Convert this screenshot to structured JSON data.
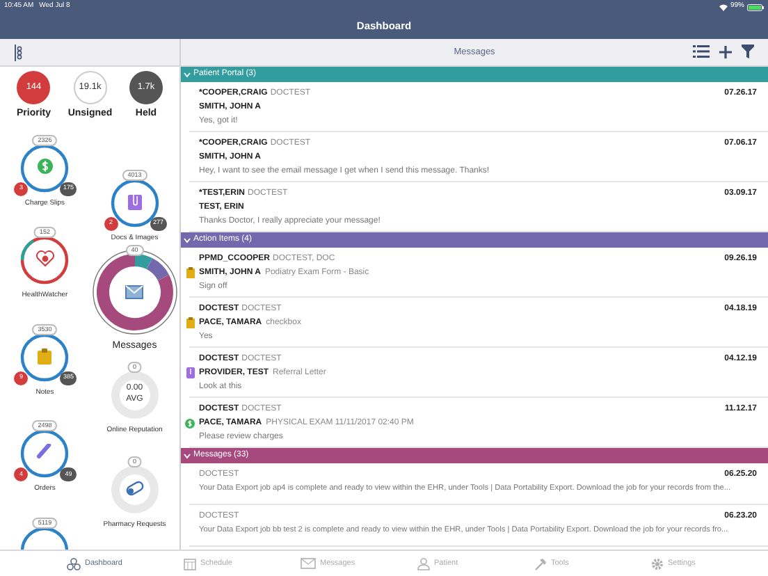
{
  "status_bar": {
    "time": "10:45 AM",
    "date": "Wed Jul 8",
    "battery": "99%"
  },
  "nav": {
    "title": "Dashboard"
  },
  "panel_header": {
    "title": "Messages"
  },
  "summary": [
    {
      "kind": "red",
      "count": "144",
      "label": "Priority"
    },
    {
      "kind": "outline",
      "count": "19.1k",
      "label": "Unsigned"
    },
    {
      "kind": "dark",
      "count": "1.7k",
      "label": "Held"
    }
  ],
  "left_widgets": [
    {
      "kind": "ring",
      "label": "Charge Slips",
      "total": "2326",
      "red": "3",
      "dark": "175"
    },
    {
      "kind": "health",
      "label": "HealthWatcher",
      "total": "152"
    },
    {
      "kind": "ring",
      "label": "Notes",
      "total": "3530",
      "red": "9",
      "dark": "385"
    },
    {
      "kind": "ring",
      "label": "Orders",
      "total": "2498",
      "red": "4",
      "dark": "49"
    },
    {
      "kind": "ring",
      "total": "5119"
    }
  ],
  "right_widgets": [
    {
      "kind": "ring",
      "label": "Docs & Images",
      "total": "4013",
      "red": "2",
      "dark": "277"
    },
    {
      "kind": "donut",
      "label": "Messages",
      "total": "40"
    },
    {
      "kind": "gauge",
      "label": "Online Reputation",
      "total": "0",
      "value": "0.00",
      "unit": "AVG"
    },
    {
      "kind": "gauge",
      "label": "Pharmacy Requests",
      "total": "0"
    }
  ],
  "sections": [
    {
      "title": "Patient Portal (3)",
      "color": "#339c9e",
      "expanded": true,
      "items": [
        {
          "kind": "portal",
          "sender": "*COOPER,CRAIG",
          "role": "DOCTEST",
          "date": "07.26.17",
          "patient": "SMITH, JOHN A",
          "body": "Yes, got it!"
        },
        {
          "kind": "portal",
          "sender": "*COOPER,CRAIG",
          "role": "DOCTEST",
          "date": "07.06.17",
          "patient": "SMITH, JOHN A",
          "body": "Hey, I want to see the email message I get when I send this message.  Thanks!"
        },
        {
          "kind": "portal",
          "sender": "*TEST,ERIN",
          "role": "DOCTEST",
          "date": "03.09.17",
          "patient": "TEST, ERIN",
          "body": "Thanks Doctor, I really appreciate your message!"
        }
      ]
    },
    {
      "title": "Action Items (4)",
      "color": "#7469ad",
      "expanded": true,
      "items": [
        {
          "kind": "form",
          "sender": "PPMD_CCOOPER",
          "role": "DOCTEST, DOC",
          "date": "09.26.19",
          "patient": "SMITH, JOHN A",
          "subject": "Podiatry Exam Form - Basic",
          "body": "Sign off"
        },
        {
          "kind": "form",
          "sender": "DOCTEST",
          "role": "DOCTEST",
          "date": "04.18.19",
          "patient": "PACE, TAMARA",
          "subject": "checkbox",
          "body": "Yes"
        },
        {
          "kind": "letter",
          "sender": "DOCTEST",
          "role": "DOCTEST",
          "date": "04.12.19",
          "patient": "PROVIDER, TEST",
          "subject": "Referral Letter",
          "body": "Look at this"
        },
        {
          "kind": "charge",
          "sender": "DOCTEST",
          "role": "DOCTEST",
          "date": "11.12.17",
          "patient": "PACE, TAMARA",
          "subject": "PHYSICAL EXAM 11/11/2017 02:40 PM",
          "body": "Please review charges"
        }
      ]
    },
    {
      "title": "Messages (33)",
      "color": "#a64a7e",
      "expanded": true,
      "items": [
        {
          "kind": "message",
          "role": "DOCTEST",
          "date": "06.25.20",
          "body": "Your Data Export job ap4 is complete and ready to view within the EHR, under Tools | Data Portability Export. Download the job for your records from the..."
        },
        {
          "kind": "message",
          "role": "DOCTEST",
          "date": "06.23.20",
          "body": "Your Data Export job bb test 2 is complete and ready to view within the EHR, under Tools | Data Portability Export. Download the job for your records fro..."
        }
      ]
    }
  ],
  "tabs": [
    {
      "label": "Dashboard",
      "selected": true
    },
    {
      "label": "Schedule",
      "selected": false
    },
    {
      "label": "Messages",
      "selected": false
    },
    {
      "label": "Patient",
      "selected": false
    },
    {
      "label": "Tools",
      "selected": false
    },
    {
      "label": "Settings",
      "selected": false
    }
  ]
}
